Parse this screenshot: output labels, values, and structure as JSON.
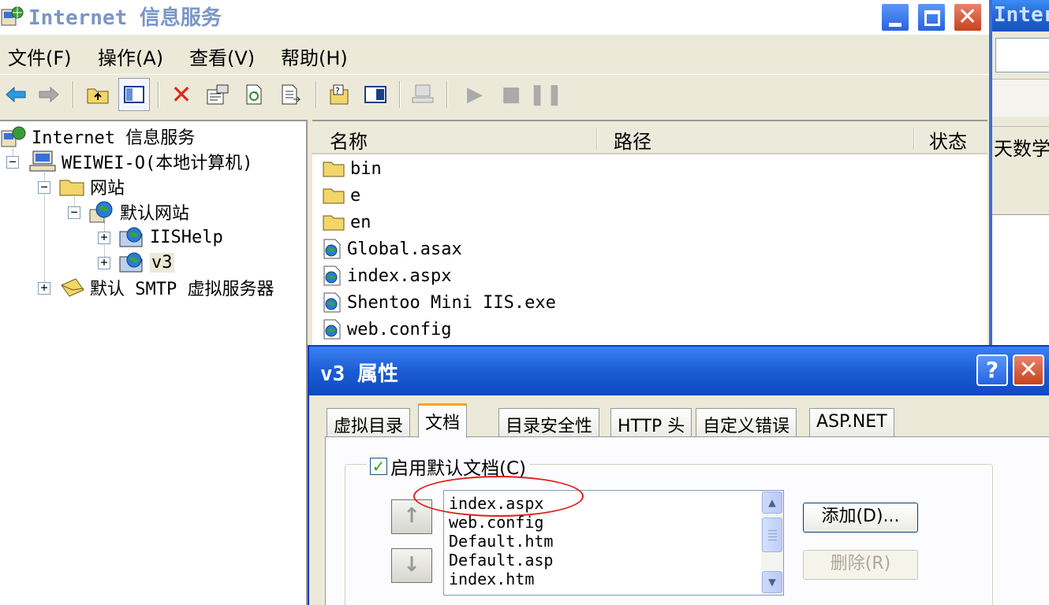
{
  "bg_window": {
    "title_fragment": "Intern",
    "text_fragment": "天数学的"
  },
  "main_window": {
    "title": "Internet 信息服务",
    "menu": [
      {
        "label": "文件(F)"
      },
      {
        "label": "操作(A)"
      },
      {
        "label": "查看(V)"
      },
      {
        "label": "帮助(H)"
      }
    ],
    "toolbar_icons": [
      "back-icon",
      "forward-icon",
      "up-folder-icon",
      "show-tree-icon",
      "delete-icon",
      "properties-icon",
      "refresh-icon",
      "export-icon",
      "help-icon",
      "show-console-icon",
      "connect-computer-icon",
      "start-icon",
      "stop-icon",
      "pause-icon"
    ],
    "tree": {
      "root": "Internet 信息服务",
      "computer": "WEIWEI-O(本地计算机)",
      "websites": "网站",
      "default_site": "默认网站",
      "iishelp": "IISHelp",
      "v3": "v3",
      "smtp": "默认 SMTP 虚拟服务器"
    },
    "list": {
      "columns": [
        "名称",
        "路径",
        "状态"
      ],
      "rows": [
        {
          "name": "bin",
          "type": "folder"
        },
        {
          "name": "e",
          "type": "folder"
        },
        {
          "name": "en",
          "type": "folder"
        },
        {
          "name": "Global.asax",
          "type": "file"
        },
        {
          "name": "index.aspx",
          "type": "file"
        },
        {
          "name": "Shentoo Mini IIS.exe",
          "type": "file"
        },
        {
          "name": "web.config",
          "type": "file"
        }
      ]
    }
  },
  "dialog": {
    "title": "v3 属性",
    "help_label": "?",
    "close_label": "✕",
    "tabs": [
      "虚拟目录",
      "文档",
      "目录安全性",
      "HTTP 头",
      "自定义错误",
      "ASP.NET"
    ],
    "active_tab": "文档",
    "enable_default_doc": {
      "label": "启用默认文档(C)",
      "checked": true
    },
    "move_up_label": "↑",
    "move_down_label": "↓",
    "documents": [
      "index.aspx",
      "web.config",
      "Default.htm",
      "Default.asp",
      "index.htm"
    ],
    "add_button": "添加(D)...",
    "remove_button": "删除(R)",
    "highlight_color": "#e0201c"
  }
}
